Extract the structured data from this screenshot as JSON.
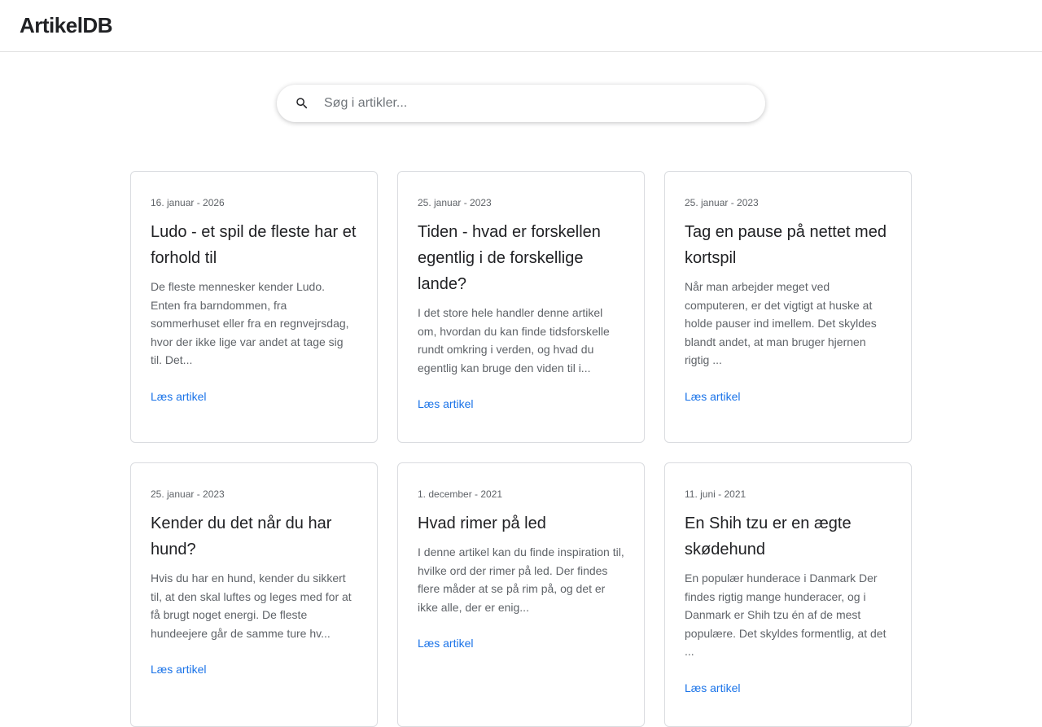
{
  "app": {
    "title": "ArtikelDB"
  },
  "search": {
    "placeholder": "Søg i artikler...",
    "icon": "search-icon"
  },
  "articles": [
    {
      "date": "16. januar - 2026",
      "title": "Ludo - et spil de fleste har et forhold til",
      "excerpt": "De fleste mennesker kender Ludo. Enten fra barndommen, fra sommerhuset eller fra en regnvejrsdag, hvor der ikke lige var andet at tage sig til. Det...",
      "link": "Læs artikel"
    },
    {
      "date": "25. januar - 2023",
      "title": "Tiden - hvad er forskellen egentlig i de forskellige lande?",
      "excerpt": "I det store hele handler denne artikel om, hvordan du kan finde tidsforskelle rundt omkring i verden, og hvad du egentlig kan bruge den viden til i...",
      "link": "Læs artikel"
    },
    {
      "date": "25. januar - 2023",
      "title": "Tag en pause på nettet med kortspil",
      "excerpt": "Når man arbejder meget ved computeren, er det vigtigt at huske at holde pauser ind imellem. Det skyldes blandt andet, at man bruger hjernen rigtig ...",
      "link": "Læs artikel"
    },
    {
      "date": "25. januar - 2023",
      "title": "Kender du det når du har hund?",
      "excerpt": "Hvis du har en hund, kender du sikkert til, at den skal luftes og leges med for at få brugt noget energi. De fleste hundeejere går de samme ture hv...",
      "link": "Læs artikel"
    },
    {
      "date": "1. december - 2021",
      "title": "Hvad rimer på led",
      "excerpt": "I denne artikel kan du finde inspiration til, hvilke ord der rimer på led. Der findes flere måder at se på rim på, og det er ikke alle, der er enig...",
      "link": "Læs artikel"
    },
    {
      "date": "11. juni - 2021",
      "title": "En Shih tzu er en ægte skødehund",
      "excerpt": "En populær hunderace i Danmark Der findes rigtig mange hunderacer, og i Danmark er Shih tzu én af de mest populære. Det skyldes formentlig, at det ...",
      "link": "Læs artikel"
    }
  ]
}
